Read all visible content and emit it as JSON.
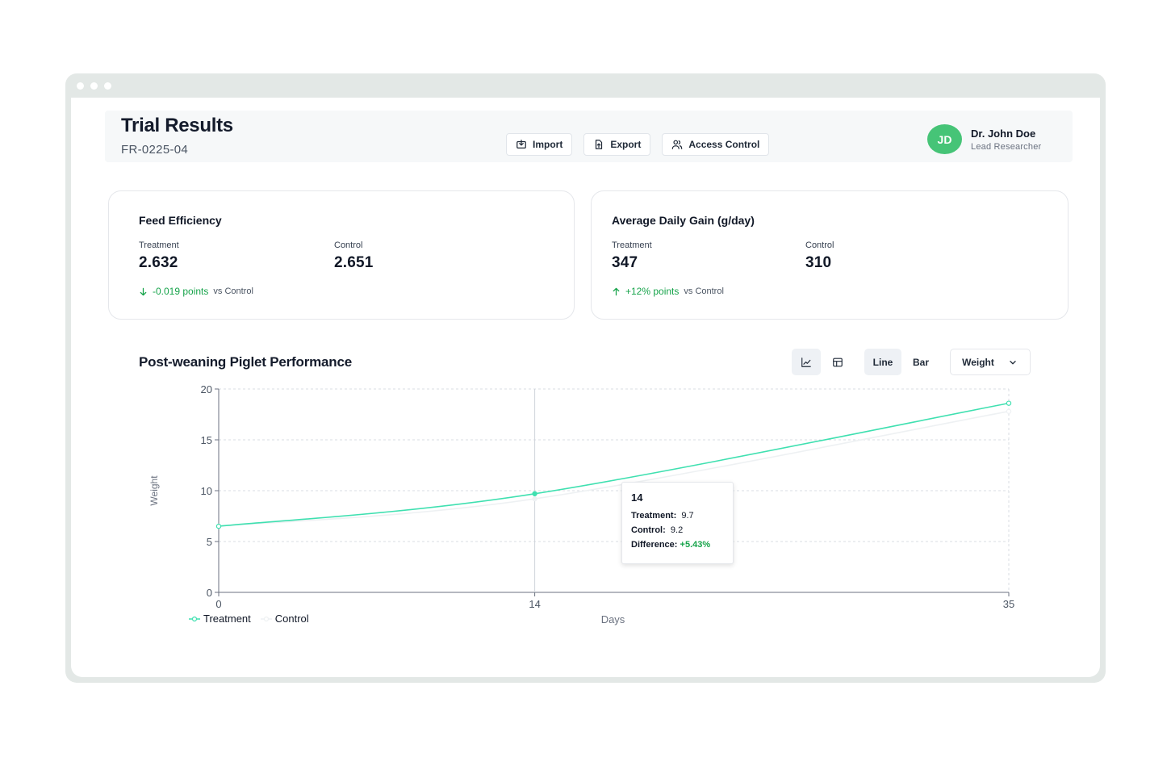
{
  "header": {
    "title": "Trial Results",
    "trial_id": "FR-0225-04",
    "actions": [
      "Import",
      "Export",
      "Access Control"
    ],
    "user": {
      "initials": "JD",
      "name": "Dr. John Doe",
      "role": "Lead Researcher"
    }
  },
  "cards": [
    {
      "title": "Feed Efficiency",
      "treatment_label": "Treatment",
      "treatment_value": "2.632",
      "control_label": "Control",
      "control_value": "2.651",
      "delta_value": "-0.019 points",
      "delta_suffix": "vs Control",
      "delta_direction": "down"
    },
    {
      "title": "Average Daily Gain (g/day)",
      "treatment_label": "Treatment",
      "treatment_value": "347",
      "control_label": "Control",
      "control_value": "310",
      "delta_value": "+12% points",
      "delta_suffix": "vs Control",
      "delta_direction": "up"
    }
  ],
  "chart_section": {
    "title": "Post-weaning Piglet Performance",
    "view_icons": [
      "line-chart-icon",
      "table-icon"
    ],
    "type_options": [
      "Line",
      "Bar"
    ],
    "selected_type": "Line",
    "metric_select": "Weight"
  },
  "chart_data": {
    "type": "line",
    "x": [
      0,
      14,
      35
    ],
    "series": [
      {
        "name": "Treatment",
        "values": [
          6.5,
          9.7,
          18.6
        ],
        "color": "#3fe0b0"
      },
      {
        "name": "Control",
        "values": [
          6.5,
          9.2,
          17.8
        ],
        "color": "#eef1f3"
      }
    ],
    "xlabel": "Days",
    "ylabel": "Weight",
    "xlim": [
      0,
      35
    ],
    "ylim": [
      0,
      20
    ],
    "xticks": [
      0,
      14,
      35
    ],
    "yticks": [
      0,
      5,
      10,
      15,
      20
    ],
    "grid": true,
    "legend": "bottom-left",
    "tooltip": {
      "title": "14",
      "treatment_label": "Treatment:",
      "treatment_value": "9.7",
      "control_label": "Control:",
      "control_value": "9.2",
      "difference_label": "Difference:",
      "difference_value": "+5.43%"
    }
  }
}
